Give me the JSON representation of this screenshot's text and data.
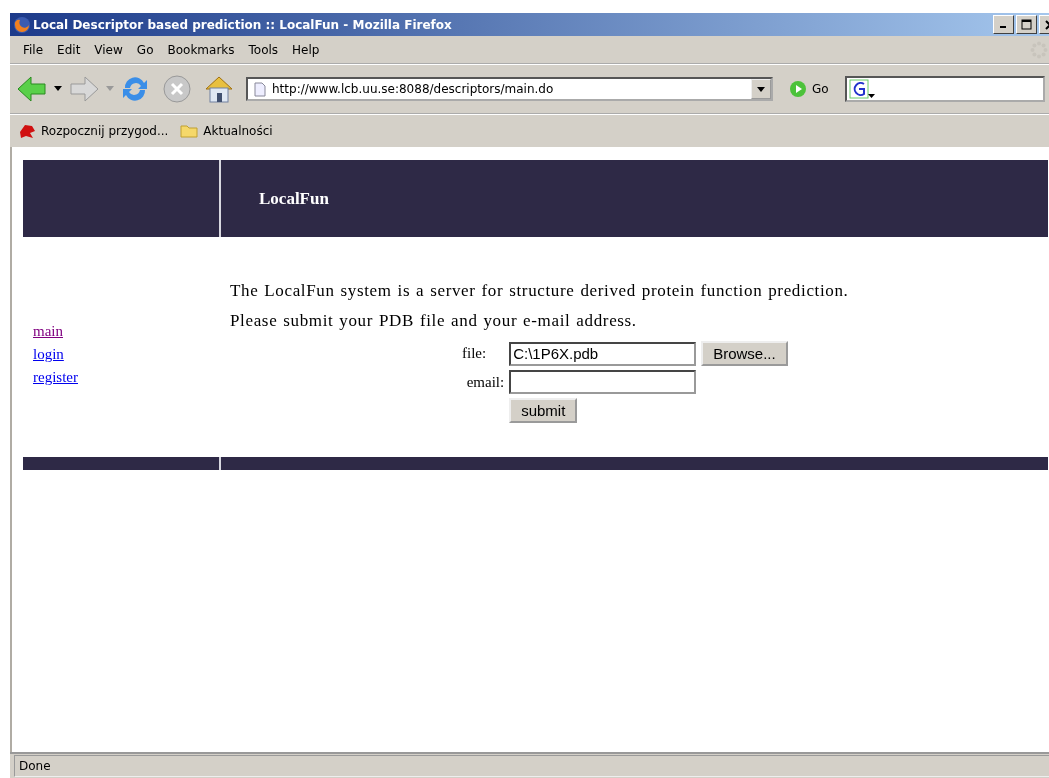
{
  "window": {
    "title": "Local Descriptor based prediction :: LocalFun - Mozilla Firefox"
  },
  "menu": [
    "File",
    "Edit",
    "View",
    "Go",
    "Bookmarks",
    "Tools",
    "Help"
  ],
  "address_bar": {
    "value": "http://www.lcb.uu.se:8088/descriptors/main.do"
  },
  "go_button": "Go",
  "bookmarks": [
    {
      "label": "Rozpocznij przygod...",
      "kind": "site"
    },
    {
      "label": "Aktualności",
      "kind": "folder"
    }
  ],
  "page": {
    "header": "LocalFun",
    "nav": [
      {
        "label": "main",
        "visited": true
      },
      {
        "label": "login",
        "visited": false
      },
      {
        "label": "register",
        "visited": false
      }
    ],
    "intro": [
      "The LocalFun system is a server for structure derived protein function prediction.",
      "Please submit your PDB file and your e-mail address."
    ],
    "form": {
      "file_label": "file:",
      "file_value": "C:\\1P6X.pdb",
      "browse_button": "Browse...",
      "email_label": "email:",
      "submit_button": "submit"
    }
  },
  "status_bar": "Done"
}
